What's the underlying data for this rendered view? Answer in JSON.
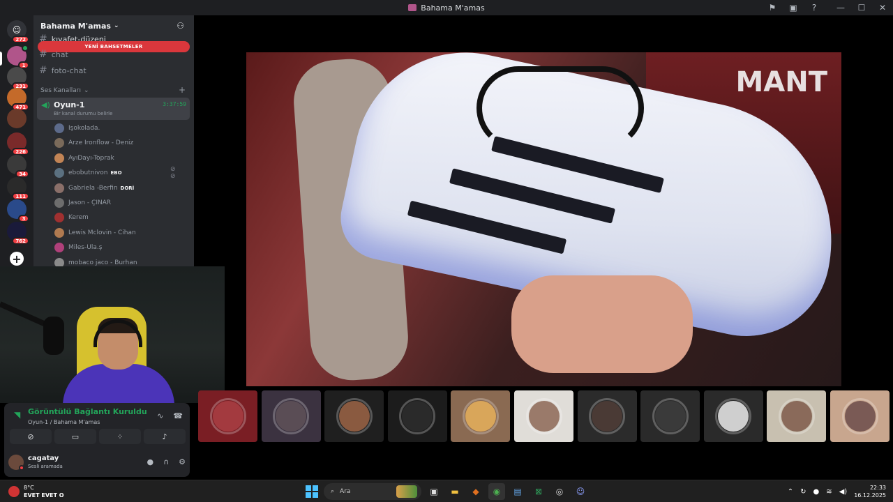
{
  "window": {
    "title": "Bahama M'amas",
    "controls": [
      "⚑",
      "▣",
      "?",
      "—",
      "☐",
      "✕"
    ]
  },
  "rail": {
    "badges": [
      "272",
      "1",
      "231",
      "471",
      "226",
      "34",
      "111",
      "3",
      "762"
    ]
  },
  "sidebar": {
    "server_name": "Bahama M'amas",
    "channels": [
      {
        "label": "kıyafet-düzeni"
      },
      {
        "label": "chat"
      },
      {
        "label": "foto-chat"
      }
    ],
    "new_mentions": "YENİ BAHSETMELER",
    "voice_category": "Ses Kanalları",
    "voice_channel": {
      "name": "Oyun-1",
      "timer": "3:37:59",
      "status": "Bir kanal durumu belirle"
    },
    "members": [
      {
        "name": "Işokolada.",
        "tag": "",
        "color": "#5c6a8a"
      },
      {
        "name": "Arze Ironflow - Deniz",
        "tag": "",
        "color": "#7a6a5a"
      },
      {
        "name": "AyıDayı-Toprak",
        "tag": "",
        "color": "#c28455"
      },
      {
        "name": "ebobutnivon",
        "tag": "EBO",
        "color": "#5b7080"
      },
      {
        "name": "Gabriela -Berfin",
        "tag": "DORİ",
        "color": "#8a6f69"
      },
      {
        "name": "Jason - ÇINAR",
        "tag": "",
        "color": "#6d6d6d"
      },
      {
        "name": "Kerem",
        "tag": "",
        "color": "#a03030"
      },
      {
        "name": "Lewis Mclovin - Cihan",
        "tag": "",
        "color": "#b07a50"
      },
      {
        "name": "Miles-Ula.ş",
        "tag": "",
        "color": "#b0407a"
      },
      {
        "name": "mobaco jaco - Burhan",
        "tag": "",
        "color": "#8a8a8a"
      }
    ]
  },
  "voice_panel": {
    "connection": "Görüntülü Bağlantı Kuruldu",
    "location": "Oyun-1 / Bahama M'amas",
    "user": {
      "name": "cagatay",
      "status": "Sesli aramada"
    }
  },
  "tiles": [
    {
      "bg": "#7a1e24",
      "face": "#a33a3f"
    },
    {
      "bg": "#3b3240",
      "face": "#5a4d55"
    },
    {
      "bg": "#1f1f1f",
      "face": "#8a5a40"
    },
    {
      "bg": "#1c1c1c",
      "face": "#2a2a2a"
    },
    {
      "bg": "#8a6a52",
      "face": "#d9a65a"
    },
    {
      "bg": "#e0ddd8",
      "face": "#9a7a6a"
    },
    {
      "bg": "#2b2b2b",
      "face": "#4a3a35"
    },
    {
      "bg": "#2a2a2a",
      "face": "#3a3a3a"
    },
    {
      "bg": "#2a2a2a",
      "face": "#cfcfcf"
    },
    {
      "bg": "#c8c0b0",
      "face": "#8a6a5a"
    },
    {
      "bg": "#c8a68e",
      "face": "#7a5a55"
    }
  ],
  "taskbar": {
    "weather_temp": "8°C",
    "ticker": "EVET EVET O",
    "search_placeholder": "Ara",
    "time": "22:33",
    "date": "16.12.2025"
  },
  "colors": {
    "accent_green": "#23a55a",
    "alert_red": "#da373c",
    "sidebar_bg": "#2b2d31"
  }
}
